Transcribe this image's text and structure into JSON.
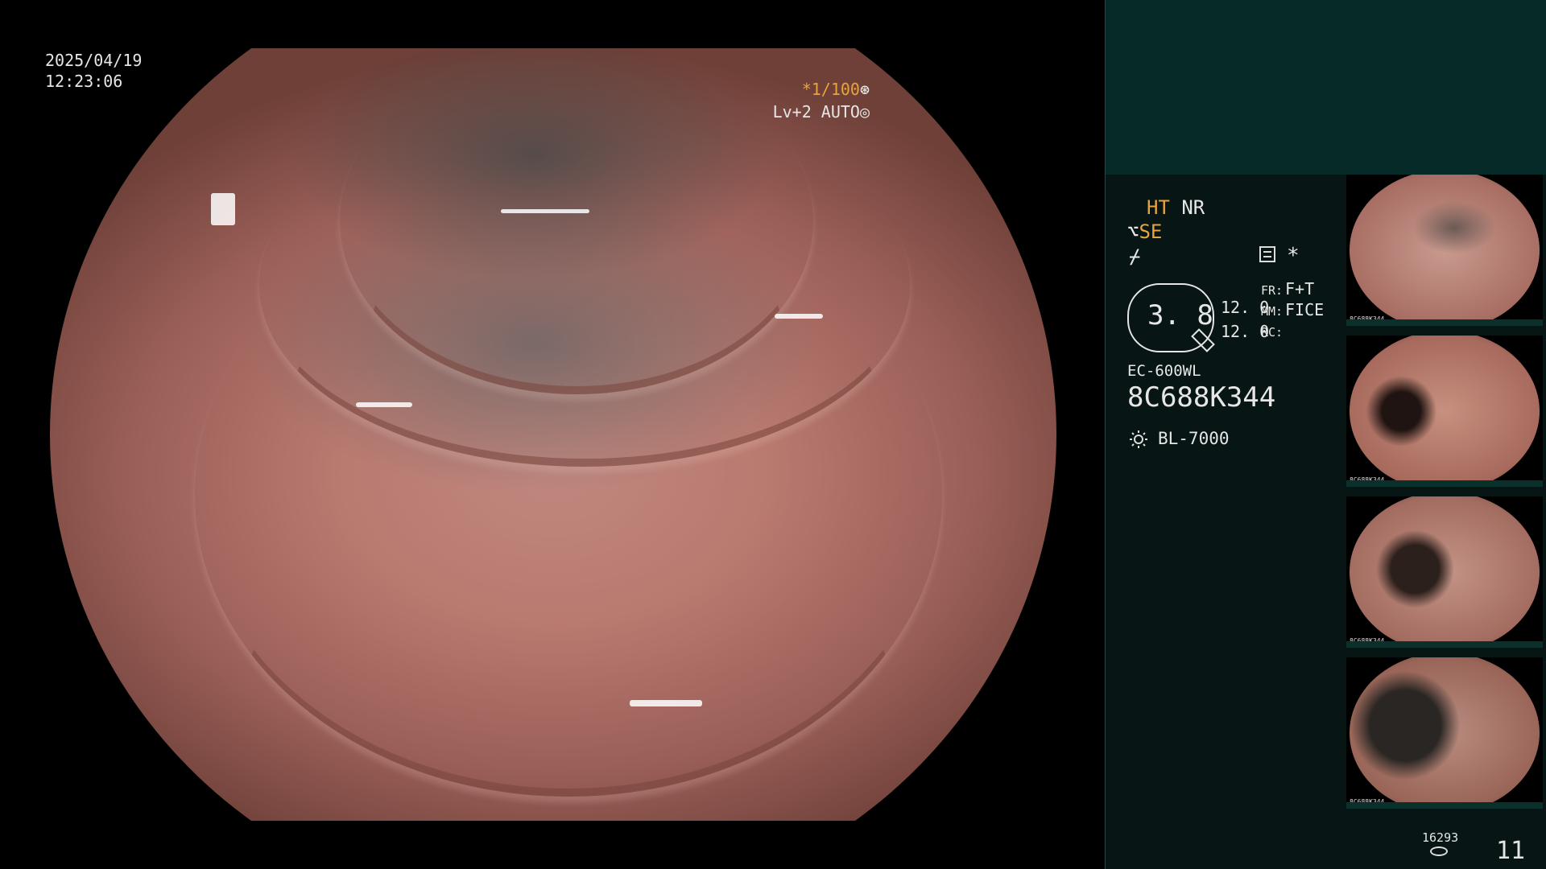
{
  "overlay": {
    "date": "2025/04/19",
    "time": "12:23:06",
    "shutter_prefix": "*",
    "shutter_value": "1/100",
    "shutter_icon": "aperture-icon",
    "exposure": "Lv+2 AUTO",
    "exposure_icon": "iris-icon"
  },
  "panel": {
    "ht": "HT",
    "nr": "NR",
    "se": "SE",
    "se_icon": "scope-tip-icon",
    "af_icon": "af-lightning-icon",
    "af_glyph": "⌿",
    "menu_icon": "settings-list-icon",
    "star": "*",
    "zoom": "3. 8",
    "val_a": "12. 0",
    "val_b": "12. 0",
    "fr_label": "FR:",
    "fr_value": "F+T",
    "mm_label": "MM:",
    "mm_value": "FICE",
    "rc_label": "RC:",
    "scope_model": "EC-600WL",
    "scope_serial": "8C688K344",
    "light_icon": "light-source-icon",
    "light_source": "BL-7000",
    "capture_count": "16293",
    "storage_icon": "storage-icon",
    "page_number": "11"
  },
  "thumbnails": [
    {
      "caption": "8C688K344"
    },
    {
      "caption": "8C688K344"
    },
    {
      "caption": "8C688K344"
    },
    {
      "caption": "8C688K344"
    }
  ],
  "colors": {
    "accent": "#e8a33b",
    "panel_top": "#062a28",
    "panel_bottom": "#071514"
  }
}
